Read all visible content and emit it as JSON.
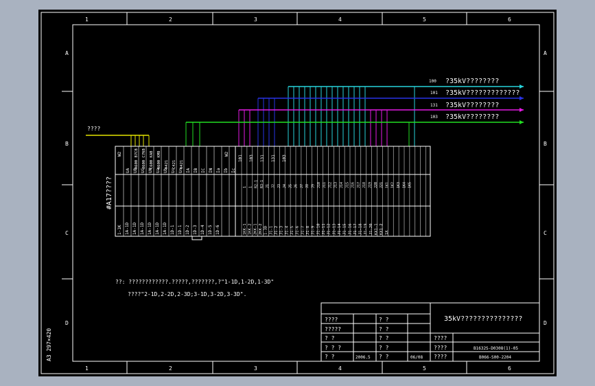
{
  "sheet": {
    "size_label": "A3 297×420",
    "col_labels": [
      "1",
      "2",
      "3",
      "4",
      "5",
      "6"
    ],
    "row_labels": [
      "A",
      "B",
      "C",
      "D"
    ]
  },
  "buses": [
    {
      "num": "100",
      "label": "?35kV????????",
      "color": "#27d4dc"
    },
    {
      "num": "101",
      "label": "?35kV?????????????",
      "color": "#2933e6"
    },
    {
      "num": "131",
      "label": "?35kV????????",
      "color": "#e61ae6"
    },
    {
      "num": "103",
      "label": "?35kV????????",
      "color": "#22e022"
    }
  ],
  "input": {
    "label": "????",
    "color": "#e6e600"
  },
  "terminal_block": {
    "title": "#A17????",
    "w_labels": [
      "W2",
      "W2"
    ],
    "top_group1": [
      "UA",
      "UB",
      "UC",
      "UN",
      "Ua",
      "Ub",
      "Uc",
      "Un",
      "IA",
      "IB",
      "IC",
      "IN",
      "Ia",
      "Ib",
      "Ic"
    ],
    "wire_group1": [
      "A600 B7CB",
      "B600 C7NB",
      "C600 KAB",
      "N600 KMB",
      "A421",
      "C421",
      "N421"
    ],
    "mid_labels": [
      "101",
      "103",
      "131",
      "131",
      "103"
    ],
    "row1_group2": [
      "1",
      "1",
      "R2-1",
      "R3-1",
      "J1",
      "J2",
      "J3",
      "J4",
      "J5",
      "J6",
      "J7",
      "J8",
      "J9",
      "J10",
      "J11",
      "J12",
      "J13",
      "J14",
      "J15",
      "J16",
      "J17",
      "J18",
      "J19",
      "J20",
      "J21",
      "1K1",
      "1K2",
      "1K3",
      "1K4",
      "1K5"
    ],
    "bottom_group1": [
      "1-1K",
      "1A-1D",
      "1A-1D",
      "1A-1D",
      "1A-1D",
      "1A-1D",
      "1A-1D",
      "1D-1",
      "1D-1",
      "1D-2",
      "1D-3",
      "1D-4",
      "1D-5",
      "1D-6"
    ],
    "bottom_group2": [
      "1KK-1",
      "1KK-2",
      "2KK-1",
      "2KK-2",
      "1-3D",
      "J1-1",
      "J1-2",
      "J1-3",
      "J1-4",
      "J1-5",
      "J1-6",
      "J1-7",
      "J1-8",
      "J1-9",
      "J1-10",
      "J1-11",
      "J1-12",
      "J1-13",
      "J1-14",
      "J1-15",
      "J1-16",
      "J1-17",
      "J1-18",
      "J1-19",
      "J1-20",
      "KX1-1",
      "KX1-2",
      "1X"
    ]
  },
  "notes": {
    "line1": "??:  ????????????.?????,???????,?\"1-1D,1-2D,1-3D\"",
    "line2": "????\"2-1D,2-2D,2-3D;3-1D,3-2D,3-3D\"."
  },
  "title_block": {
    "title": "35kV???????????????",
    "rows": [
      {
        "a": "????",
        "b": "",
        "c": "?  ?",
        "d": ""
      },
      {
        "a": "?????",
        "b": "",
        "c": "?  ?",
        "d": ""
      },
      {
        "a": "?   ?",
        "b": "",
        "c": "?  ?",
        "d": ""
      },
      {
        "a": "?  ? ?",
        "b": "",
        "c": "?  ?",
        "d": ""
      },
      {
        "a": "?   ?",
        "b": "2006.5",
        "c": "?  ?",
        "d": "06/08"
      }
    ],
    "drawing_no_1": "B1632S-D0308(1)-05",
    "drawing_no_2": "B066-S00-2204",
    "right_labels": [
      "????",
      "????",
      "????"
    ]
  },
  "colors": {
    "background": "#000000",
    "outer": "#a9b2c0",
    "lines": "#ffffff"
  }
}
